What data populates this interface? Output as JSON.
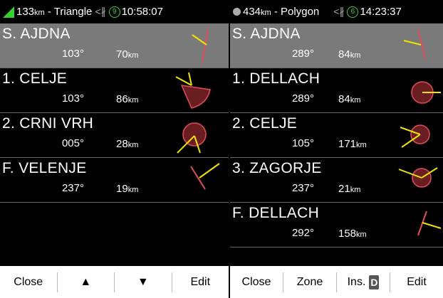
{
  "left": {
    "status": {
      "distance": "133",
      "unit": "km",
      "task": "Triangle",
      "sats": "9",
      "time": "10:58:07"
    },
    "waypoints": [
      {
        "name": "S. AJDNA",
        "bearing": "103°",
        "distance": "70",
        "unit": "km"
      },
      {
        "name": "1. CELJE",
        "bearing": "103°",
        "distance": "86",
        "unit": "km"
      },
      {
        "name": "2. CRNI VRH",
        "bearing": "005°",
        "distance": "28",
        "unit": "km"
      },
      {
        "name": "F. VELENJE",
        "bearing": "237°",
        "distance": "19",
        "unit": "km"
      }
    ],
    "buttons": {
      "close": "Close",
      "up": "▲",
      "down": "▼",
      "edit": "Edit"
    }
  },
  "right": {
    "status": {
      "distance": "434",
      "unit": "km",
      "task": "Polygon",
      "sats": "6",
      "time": "14:23:37"
    },
    "waypoints": [
      {
        "name": "S. AJDNA",
        "bearing": "289°",
        "distance": "84",
        "unit": "km"
      },
      {
        "name": "1. DELLACH",
        "bearing": "289°",
        "distance": "84",
        "unit": "km"
      },
      {
        "name": "2. CELJE",
        "bearing": "105°",
        "distance": "171",
        "unit": "km"
      },
      {
        "name": "3. ZAGORJE",
        "bearing": "237°",
        "distance": "21",
        "unit": "km"
      },
      {
        "name": "F. DELLACH",
        "bearing": "292°",
        "distance": "158",
        "unit": "km"
      }
    ],
    "buttons": {
      "close": "Close",
      "zone": "Zone",
      "ins": "Ins.",
      "ins_badge": "D",
      "edit": "Edit"
    }
  },
  "colors": {
    "gps": "#37d12f",
    "selected_row": "#7a7a7a",
    "zone_stroke": "#e24d5a",
    "course_line": "#f2e200"
  },
  "icons": [
    "gps-fix-icon",
    "gps-satellite-icon",
    "bluetooth-icon",
    "start-line-icon",
    "sector-zone-icon",
    "cylinder-zone-icon",
    "finish-line-icon"
  ]
}
